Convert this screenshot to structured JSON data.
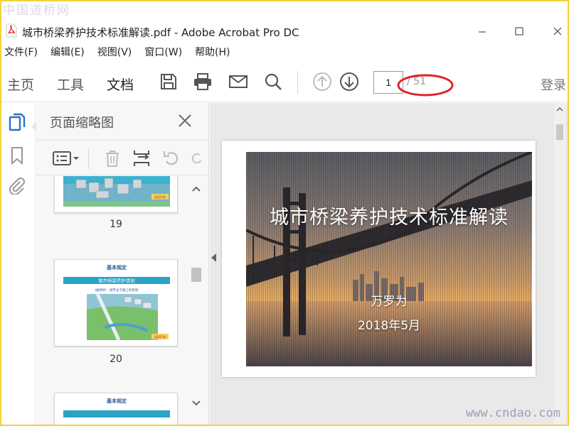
{
  "watermarks": {
    "top": "中国道桥网",
    "bottom": "www.cndao.com"
  },
  "window": {
    "title": "城市桥梁养护技术标准解读.pdf - Adobe Acrobat Pro DC"
  },
  "menu": [
    "文件(F)",
    "编辑(E)",
    "视图(V)",
    "窗口(W)",
    "帮助(H)"
  ],
  "toolbar": {
    "tabs": [
      "主页",
      "工具",
      "文档"
    ],
    "active_tab": "文档",
    "icons": [
      "save-icon",
      "print-icon",
      "mail-icon",
      "search-icon",
      "page-up-icon",
      "page-down-icon"
    ],
    "current_page": "1",
    "page_total": "/ 51",
    "login_label": "登录"
  },
  "nav_rail": {
    "icons": [
      "page-thumbnails-icon",
      "bookmark-icon",
      "attachment-icon"
    ]
  },
  "thumb_panel": {
    "title": "页面缩略图",
    "tools": [
      "options-menu-icon",
      "delete-icon",
      "insert-icon",
      "undo-icon",
      "redo-icon"
    ],
    "thumbnails": [
      {
        "page": "19",
        "badge": "返回目录"
      },
      {
        "page": "20",
        "heading": "基本规定",
        "subheading": "城市桥梁养护类别",
        "caption": "Ⅱ类养护：城市主干路上的桥梁",
        "badge": "返回目录"
      },
      {
        "heading": "基本规定"
      }
    ]
  },
  "document": {
    "slide_title": "城市桥梁养护技术标准解读",
    "author": "万罗为",
    "date": "2018年5月"
  },
  "colors": {
    "accent_blue": "#2a73c9",
    "highlight_red": "#e0242a",
    "frame_yellow": "#f2d23a",
    "thumb_header_blue": "#29a3c6"
  }
}
